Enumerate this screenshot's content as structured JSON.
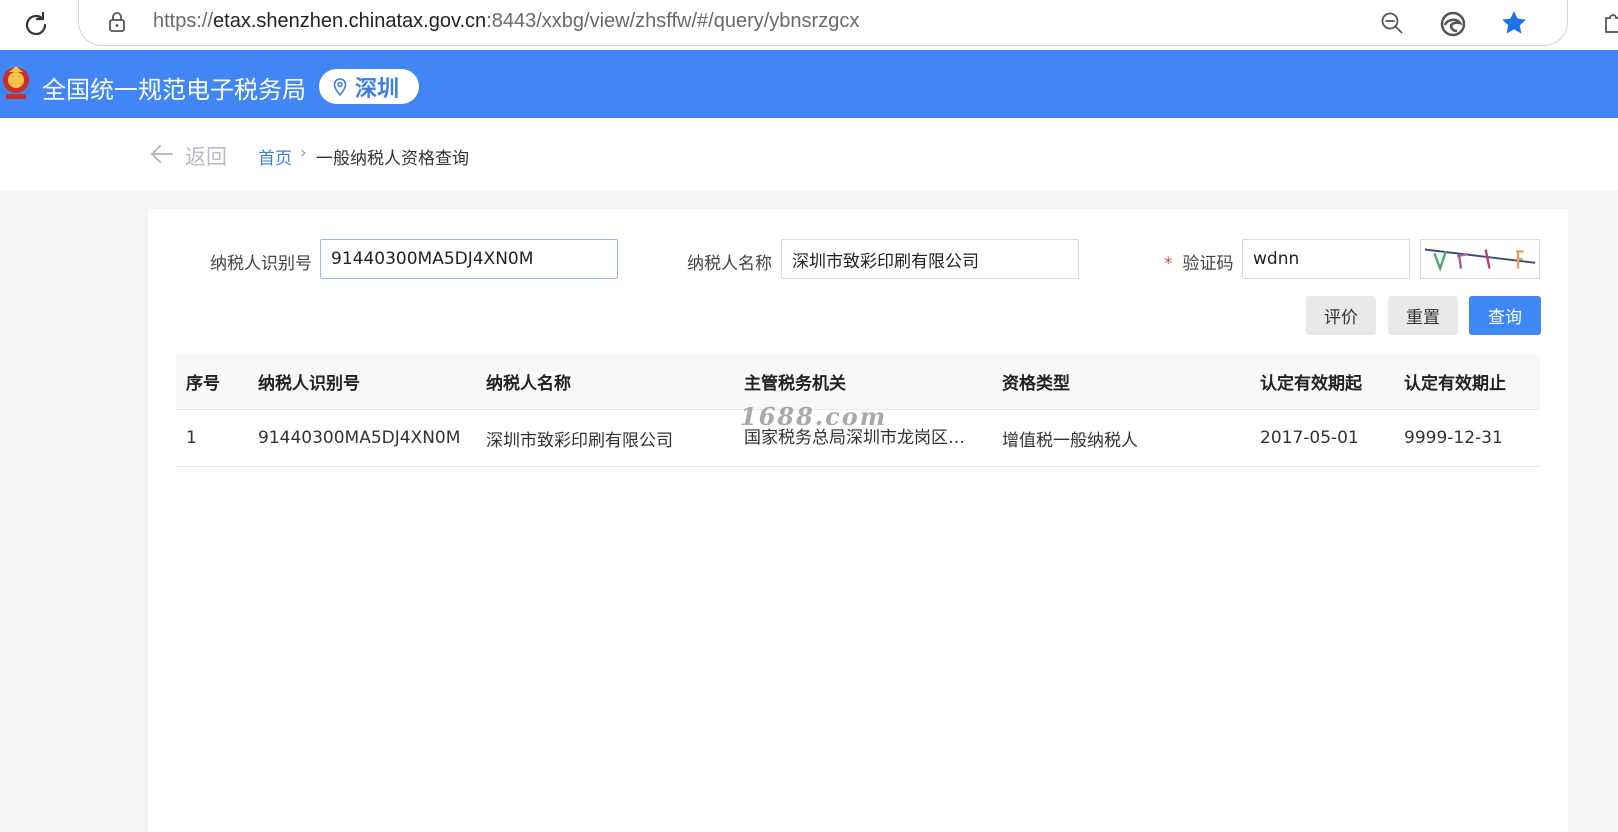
{
  "browser": {
    "url_prefix": "https://",
    "url_host": "etax.shenzhen.chinatax.gov.cn",
    "url_rest": ":8443/xxbg/view/zhsffw/#/query/ybnsrzgcx"
  },
  "header": {
    "title": "全国统一规范电子税务局",
    "city": "深圳"
  },
  "breadcrumb": {
    "back": "返回",
    "home": "首页",
    "separator": "›",
    "current": "一般纳税人资格查询"
  },
  "form": {
    "taxpayer_id_label": "纳税人识别号",
    "taxpayer_id_value": "91440300MA5DJ4XN0M",
    "taxpayer_name_label": "纳税人名称",
    "taxpayer_name_value": "深圳市致彩印刷有限公司",
    "captcha_required_mark": "*",
    "captcha_label": "验证码",
    "captcha_value": "wdnn"
  },
  "buttons": {
    "evaluate": "评价",
    "reset": "重置",
    "query": "查询"
  },
  "table": {
    "columns": [
      "序号",
      "纳税人识别号",
      "纳税人名称",
      "主管税务机关",
      "资格类型",
      "认定有效期起",
      "认定有效期止"
    ],
    "rows": [
      [
        "1",
        "91440300MA5DJ4XN0M",
        "深圳市致彩印刷有限公司",
        "国家税务总局深圳市龙岗区税务局",
        "增值税一般纳税人",
        "2017-05-01",
        "9999-12-31"
      ]
    ]
  },
  "watermark": "1688.com",
  "colors": {
    "header_blue": "#4285f4",
    "primary_button": "#3f87f5",
    "link_blue": "#3b82d6",
    "required_red": "#e54848"
  }
}
